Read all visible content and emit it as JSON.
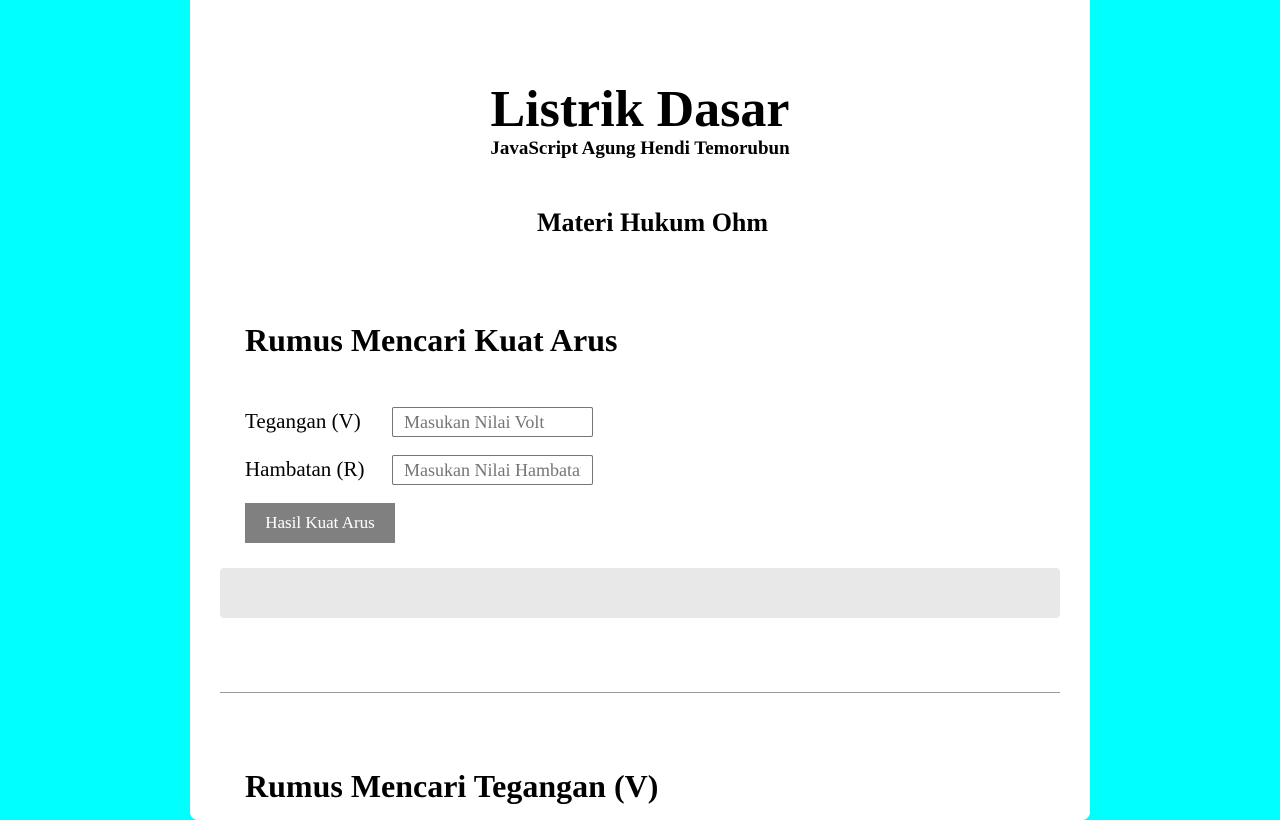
{
  "header": {
    "title": "Listrik Dasar",
    "subtitle": "JavaScript Agung Hendi Temorubun",
    "materi": "Materi Hukum Ohm"
  },
  "section_arus": {
    "heading": "Rumus Mencari Kuat Arus",
    "voltage_label": "Tegangan (V)",
    "voltage_placeholder": "Masukan Nilai Volt",
    "voltage_value": "",
    "resistance_label": "Hambatan (R)",
    "resistance_placeholder": "Masukan Nilai Hambatan",
    "resistance_value": "",
    "button_label": "Hasil Kuat Arus",
    "result_text": ""
  },
  "section_tegangan": {
    "heading": "Rumus Mencari Tegangan (V)"
  },
  "colors": {
    "page_background": "#00ffff",
    "card_background": "#ffffff",
    "button_background": "#808080",
    "result_background": "#e8e8e8"
  }
}
